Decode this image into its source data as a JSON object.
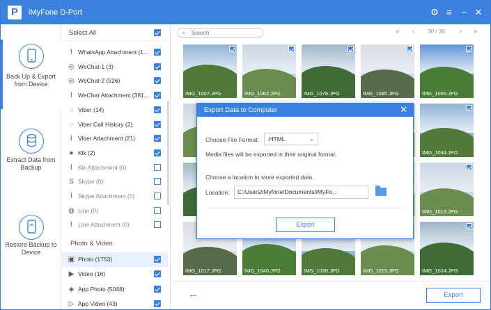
{
  "app": {
    "logo_letter": "P",
    "title": "iMyFone D-Port"
  },
  "colors": {
    "accent": "#3b82e0"
  },
  "titlebar_icons": [
    "gear-icon",
    "menu-icon",
    "minimize-icon",
    "close-icon"
  ],
  "nav": [
    {
      "label": "Back Up & Export from Device",
      "icon": "phone-export-icon",
      "active": true
    },
    {
      "label": "Extract Data from Backup",
      "icon": "database-icon",
      "active": false
    },
    {
      "label": "Restore Backup to Device",
      "icon": "phone-restore-icon",
      "active": false
    }
  ],
  "categories": {
    "select_all": "Select All",
    "items": [
      {
        "label": "WhatsApp Attachment (1...",
        "checked": true,
        "enabled": true,
        "icon": "paperclip-icon"
      },
      {
        "label": "WeChat-1 (3)",
        "checked": true,
        "enabled": true,
        "icon": "wechat-icon"
      },
      {
        "label": "WeChat-2 (526)",
        "checked": true,
        "enabled": true,
        "icon": "wechat-icon"
      },
      {
        "label": "WeChat Attachment (381...",
        "checked": true,
        "enabled": true,
        "icon": "paperclip-icon"
      },
      {
        "label": "Viber (14)",
        "checked": true,
        "enabled": true,
        "icon": "viber-icon"
      },
      {
        "label": "Viber Call History (2)",
        "checked": true,
        "enabled": true,
        "icon": "viber-icon"
      },
      {
        "label": "Viber Attachment (21)",
        "checked": true,
        "enabled": true,
        "icon": "paperclip-icon"
      },
      {
        "label": "Kik (2)",
        "checked": true,
        "enabled": true,
        "icon": "kik-icon"
      },
      {
        "label": "Kik Attachment (0)",
        "checked": false,
        "enabled": false,
        "icon": "paperclip-icon"
      },
      {
        "label": "Skype (0)",
        "checked": false,
        "enabled": false,
        "icon": "skype-icon"
      },
      {
        "label": "Skype Attachment (0)",
        "checked": false,
        "enabled": false,
        "icon": "paperclip-icon"
      },
      {
        "label": "Line (0)",
        "checked": false,
        "enabled": false,
        "icon": "line-icon"
      },
      {
        "label": "Line Attachment (0)",
        "checked": false,
        "enabled": false,
        "icon": "paperclip-icon"
      }
    ],
    "section_photo": "Photo & Video",
    "photo_items": [
      {
        "label": "Photo (1753)",
        "checked": true,
        "selected": true,
        "icon": "photo-icon"
      },
      {
        "label": "Video (16)",
        "checked": true,
        "selected": false,
        "icon": "video-icon"
      },
      {
        "label": "App Photo (5048)",
        "checked": true,
        "selected": false,
        "icon": "app-photo-icon"
      },
      {
        "label": "App Video (43)",
        "checked": true,
        "selected": false,
        "icon": "app-video-icon"
      }
    ]
  },
  "toolbar": {
    "search_placeholder": "Search",
    "page": "30 / 36"
  },
  "photos": [
    [
      "IMG_1007.JPG",
      "IMG_1082.JPG",
      "IMG_1078.JPG",
      "IMG_1080.JPG",
      "IMG_1055.JPG"
    ],
    [
      "",
      "",
      "",
      "",
      "IMG_1034.JPG"
    ],
    [
      "",
      "",
      "",
      "",
      "IMG_1013.JPG"
    ],
    [
      "IMG_1017.JPG",
      "IMG_1040.JPG",
      "IMG_1036.JPG",
      "IMG_1015.JPG",
      "IMG_1024.JPG"
    ]
  ],
  "footer": {
    "back_icon": "back-arrow-icon",
    "export_label": "Export"
  },
  "dialog": {
    "title": "Export Data to Computer",
    "format_label": "Choose File Format:",
    "format_value": ".HTML",
    "format_note": "Media files will be exported in their original format.",
    "location_prompt": "Choose a location to store exported data.",
    "location_label": "Location:",
    "location_value": "C:/Users/iMyfone/Documents/iMyFo...",
    "export_label": "Export"
  }
}
